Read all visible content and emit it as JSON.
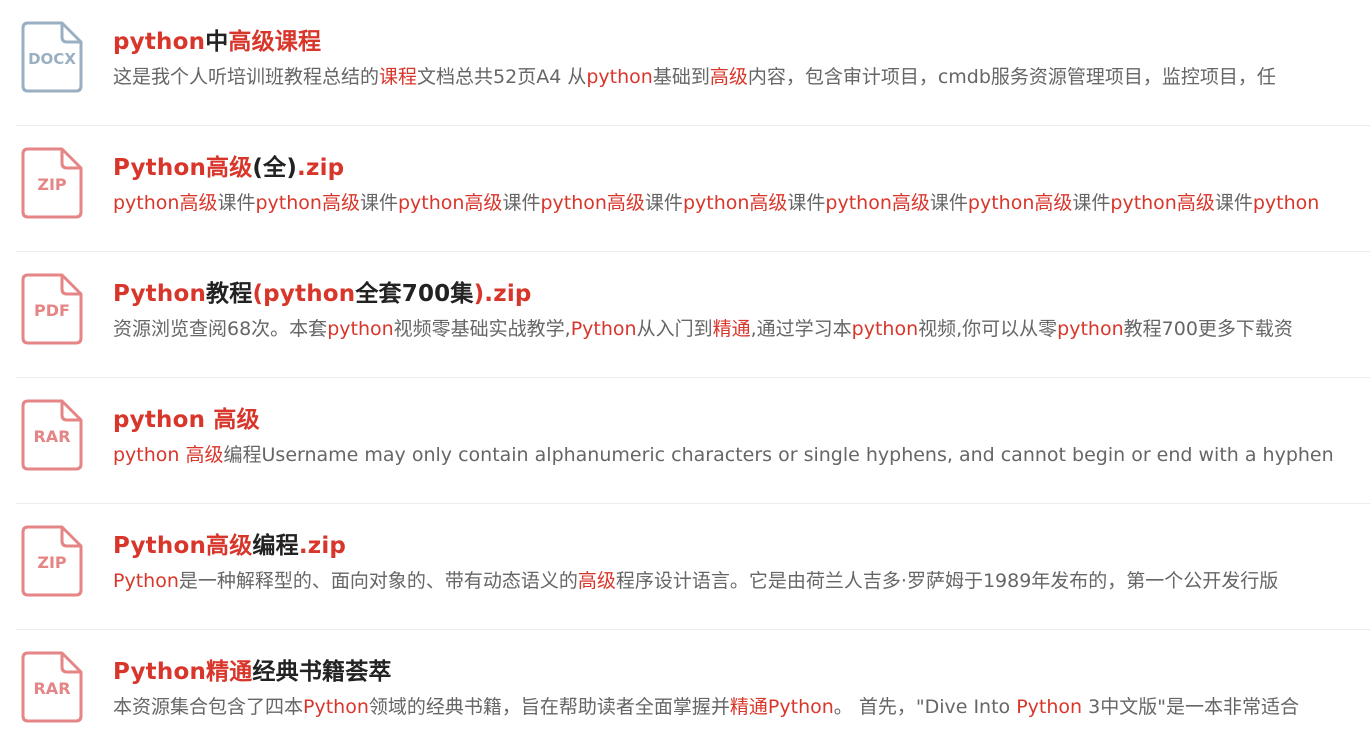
{
  "colors": {
    "highlight": "#d9362b",
    "title": "#222222",
    "desc": "#666666",
    "docx_icon": "#9ab0c2",
    "red_icon": "#e58585"
  },
  "results": [
    {
      "file_type": "DOCX",
      "icon": "docx-file-icon",
      "icon_color": "#9ab0c2",
      "title": [
        {
          "t": "python",
          "hl": true
        },
        {
          "t": "中",
          "hl": false
        },
        {
          "t": "高级课程",
          "hl": true
        }
      ],
      "desc": [
        {
          "t": "这是我个人听培训班教程总结的",
          "hl": false
        },
        {
          "t": "课程",
          "hl": true
        },
        {
          "t": "文档总共52页A4 从",
          "hl": false
        },
        {
          "t": "python",
          "hl": true
        },
        {
          "t": "基础到",
          "hl": false
        },
        {
          "t": "高级",
          "hl": true
        },
        {
          "t": "内容，包含审计项目，cmdb服务资源管理项目，监控项目，任",
          "hl": false
        }
      ]
    },
    {
      "file_type": "ZIP",
      "icon": "zip-file-icon",
      "icon_color": "#e58585",
      "title": [
        {
          "t": "Python高级",
          "hl": true
        },
        {
          "t": "(全)",
          "hl": false
        },
        {
          "t": ".zip",
          "hl": true
        }
      ],
      "desc": [
        {
          "t": "python高级",
          "hl": true
        },
        {
          "t": "课件",
          "hl": false
        },
        {
          "t": "python高级",
          "hl": true
        },
        {
          "t": "课件",
          "hl": false
        },
        {
          "t": "python高级",
          "hl": true
        },
        {
          "t": "课件",
          "hl": false
        },
        {
          "t": "python高级",
          "hl": true
        },
        {
          "t": "课件",
          "hl": false
        },
        {
          "t": "python高级",
          "hl": true
        },
        {
          "t": "课件",
          "hl": false
        },
        {
          "t": "python高级",
          "hl": true
        },
        {
          "t": "课件",
          "hl": false
        },
        {
          "t": "python高级",
          "hl": true
        },
        {
          "t": "课件",
          "hl": false
        },
        {
          "t": "python高级",
          "hl": true
        },
        {
          "t": "课件",
          "hl": false
        },
        {
          "t": "python",
          "hl": true
        }
      ]
    },
    {
      "file_type": "PDF",
      "icon": "pdf-file-icon",
      "icon_color": "#e58585",
      "title": [
        {
          "t": "Python",
          "hl": true
        },
        {
          "t": "教程",
          "hl": false
        },
        {
          "t": "(python",
          "hl": true
        },
        {
          "t": "全套700集",
          "hl": false
        },
        {
          "t": ").zip",
          "hl": true
        }
      ],
      "desc": [
        {
          "t": "资源浏览查阅68次。本套",
          "hl": false
        },
        {
          "t": "python",
          "hl": true
        },
        {
          "t": "视频零基础实战教学,",
          "hl": false
        },
        {
          "t": "Python",
          "hl": true
        },
        {
          "t": "从入门到",
          "hl": false
        },
        {
          "t": "精通",
          "hl": true
        },
        {
          "t": ",通过学习本",
          "hl": false
        },
        {
          "t": "python",
          "hl": true
        },
        {
          "t": "视频,你可以从零",
          "hl": false
        },
        {
          "t": "python",
          "hl": true
        },
        {
          "t": "教程700更多下载资",
          "hl": false
        }
      ]
    },
    {
      "file_type": "RAR",
      "icon": "rar-file-icon",
      "icon_color": "#e58585",
      "title": [
        {
          "t": "python 高级",
          "hl": true
        }
      ],
      "desc": [
        {
          "t": "python 高级",
          "hl": true
        },
        {
          "t": "编程Username may only contain alphanumeric characters or single hyphens, and cannot begin or end with a hyphen",
          "hl": false
        }
      ]
    },
    {
      "file_type": "ZIP",
      "icon": "zip-file-icon",
      "icon_color": "#e58585",
      "title": [
        {
          "t": "Python高级",
          "hl": true
        },
        {
          "t": "编程",
          "hl": false
        },
        {
          "t": ".zip",
          "hl": true
        }
      ],
      "desc": [
        {
          "t": "Python",
          "hl": true
        },
        {
          "t": "是一种解释型的、面向对象的、带有动态语义的",
          "hl": false
        },
        {
          "t": "高级",
          "hl": true
        },
        {
          "t": "程序设计语言。它是由荷兰人吉多·罗萨姆于1989年发布的，第一个公开发行版",
          "hl": false
        }
      ]
    },
    {
      "file_type": "RAR",
      "icon": "rar-file-icon",
      "icon_color": "#e58585",
      "title": [
        {
          "t": "Python精通",
          "hl": true
        },
        {
          "t": "经典书籍荟萃",
          "hl": false
        }
      ],
      "desc": [
        {
          "t": "本资源集合包含了四本",
          "hl": false
        },
        {
          "t": "Python",
          "hl": true
        },
        {
          "t": "领域的经典书籍，旨在帮助读者全面掌握并",
          "hl": false
        },
        {
          "t": "精通",
          "hl": true
        },
        {
          "t": "Python",
          "hl": true
        },
        {
          "t": "。 首先，\"Dive Into ",
          "hl": false
        },
        {
          "t": "Python",
          "hl": true
        },
        {
          "t": " 3中文版\"是一本非常适合",
          "hl": false
        }
      ]
    }
  ]
}
